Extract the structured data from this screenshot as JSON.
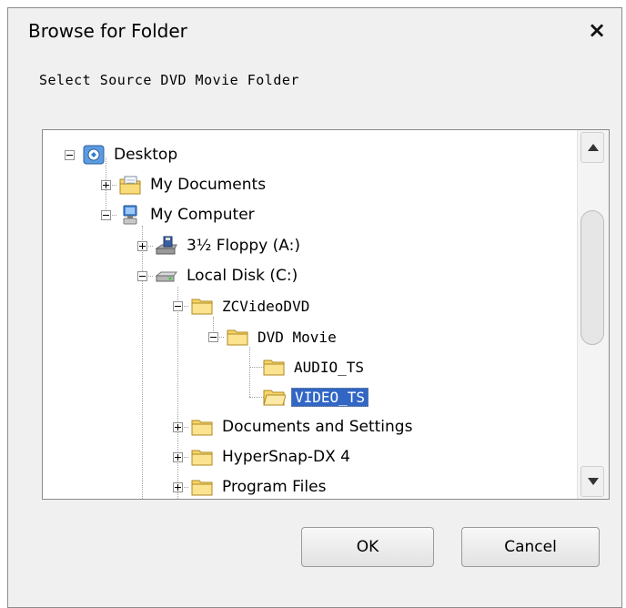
{
  "dialog": {
    "title": "Browse for Folder",
    "close_glyph": "×",
    "prompt": "Select Source DVD Movie Folder"
  },
  "tree": {
    "nodes": [
      {
        "label": "Desktop",
        "icon": "desktop-icon",
        "toggle": "minus",
        "expanded": true
      },
      {
        "label": "My Documents",
        "icon": "my-documents-icon",
        "toggle": "plus",
        "expanded": false
      },
      {
        "label": "My Computer",
        "icon": "my-computer-icon",
        "toggle": "minus",
        "expanded": true
      },
      {
        "label": "3½ Floppy (A:)",
        "icon": "floppy-drive-icon",
        "toggle": "plus",
        "expanded": false
      },
      {
        "label": "Local Disk (C:)",
        "icon": "hard-disk-icon",
        "toggle": "minus",
        "expanded": true
      },
      {
        "label": "ZCVideoDVD",
        "icon": "folder-icon",
        "toggle": "minus",
        "expanded": true
      },
      {
        "label": "DVD Movie",
        "icon": "folder-icon",
        "toggle": "minus",
        "expanded": true
      },
      {
        "label": "AUDIO_TS",
        "icon": "folder-icon",
        "toggle": "none",
        "expanded": false
      },
      {
        "label": "VIDEO_TS",
        "icon": "folder-icon",
        "toggle": "none",
        "expanded": false,
        "selected": true
      },
      {
        "label": "Documents and Settings",
        "icon": "folder-icon",
        "toggle": "plus",
        "expanded": false
      },
      {
        "label": "HyperSnap-DX 4",
        "icon": "folder-icon",
        "toggle": "plus",
        "expanded": false
      },
      {
        "label": "Program Files",
        "icon": "folder-icon",
        "toggle": "plus",
        "expanded": false
      }
    ]
  },
  "buttons": {
    "ok": "OK",
    "cancel": "Cancel"
  },
  "colors": {
    "selection": "#3166c4",
    "dialog_bg": "#f0f0f0",
    "folder": "#f5d56b"
  }
}
